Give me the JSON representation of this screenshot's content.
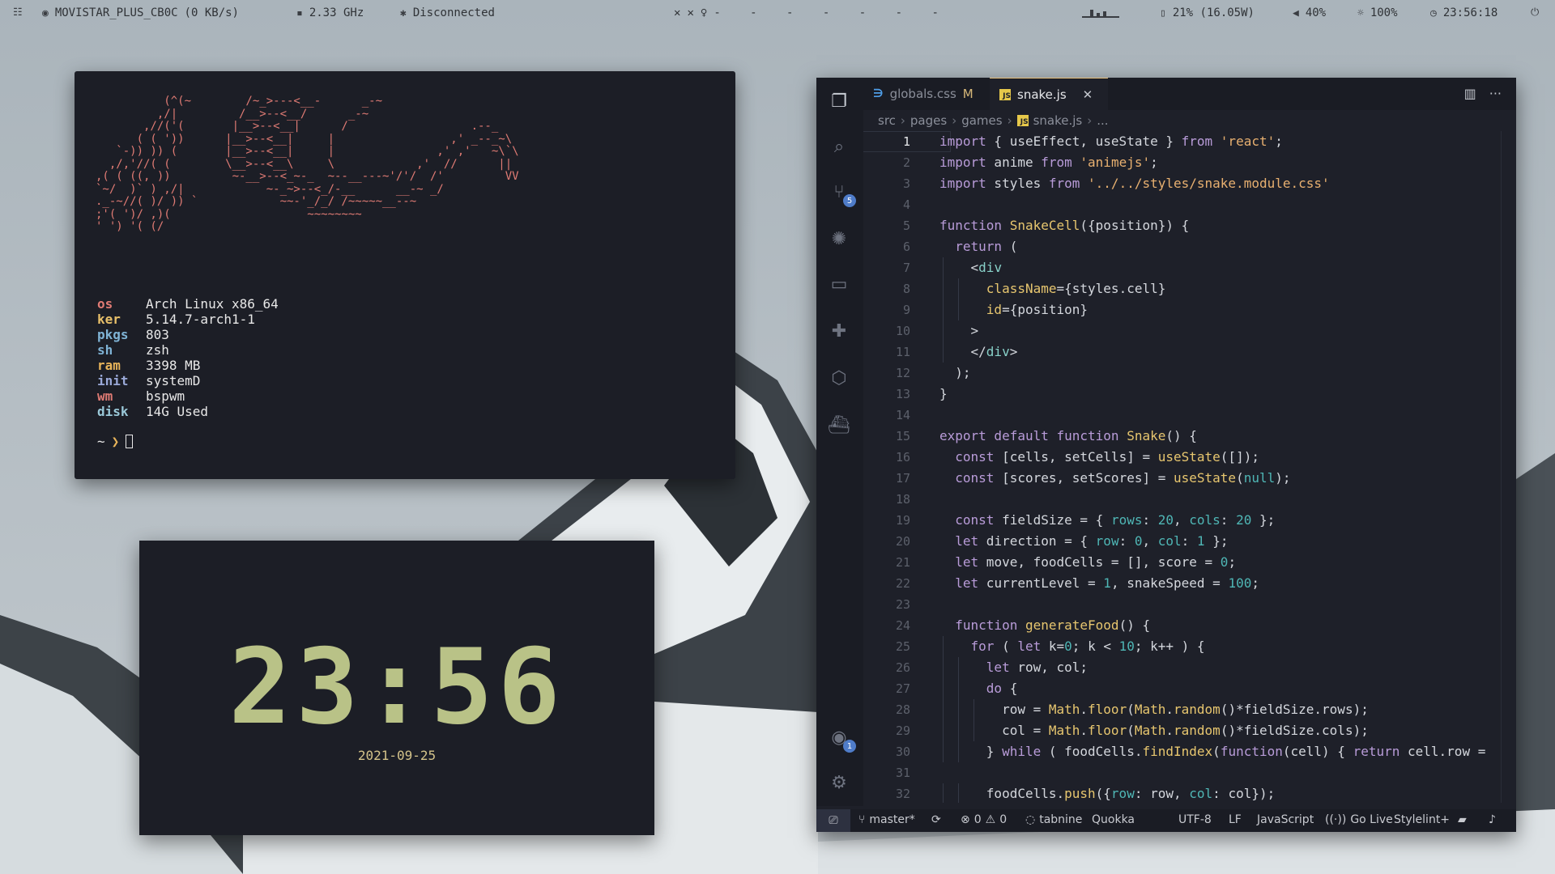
{
  "topbar": {
    "wifi_name": "MOVISTAR_PLUS_CB0C",
    "wifi_speed": "(0 KB/s)",
    "cpu_freq": "2.33 GHz",
    "bluetooth": "Disconnected",
    "workspace_dashes": "- - - - - - -",
    "battery": "21% (16.05W)",
    "volume": "40%",
    "brightness": "100%",
    "time": "23:56:18"
  },
  "terminal": {
    "ascii_art": "          (^(~        /~_>---<__-      _-~\n         ,/|         /__>--<__/      _-~\n       ,//('(       |__>--<__|      /                  .--_\n      ( ( '))      |__>--<__|     |                 ,' _--_~\\\n   `-)) )) (       |__>--<__|     |               ,' ,'   ~\\`\\\n  ,/,'//( (        \\__>--<__\\     \\            ,'  //      ||\n,( ( ((, ))         ~-__>--<_~-_  ~--__---~'/'/  /'         VV\n`~/  )` ) ,/|            ~-_~>--<_/-__      __-~ _/\n._-~//( )/ )) `            ~~-'_/_/ /~~~~~__--~\n;'( ')/ ,)(                    ~~~~~~~~\n' ') '( (/",
    "info": [
      {
        "key": "os",
        "value": "Arch Linux x86_64",
        "color": "#e07b74"
      },
      {
        "key": "ker",
        "value": "5.14.7-arch1-1",
        "color": "#e8c06a"
      },
      {
        "key": "pkgs",
        "value": "803",
        "color": "#7fb3d5"
      },
      {
        "key": "sh",
        "value": "zsh",
        "color": "#7fb3d5"
      },
      {
        "key": "ram",
        "value": "3398 MB",
        "color": "#e8b45a"
      },
      {
        "key": "init",
        "value": "systemD",
        "color": "#9aa9d8"
      },
      {
        "key": "wm",
        "value": "bspwm",
        "color": "#e07b74"
      },
      {
        "key": "disk",
        "value": "14G Used",
        "color": "#9ac8d8"
      }
    ],
    "prompt_path": "~",
    "prompt_arrow": "❯"
  },
  "clock": {
    "time": "23:56",
    "date": "2021-09-25"
  },
  "vscode": {
    "tabs": [
      {
        "label": "globals.css",
        "modified": "M",
        "type": "css",
        "active": false
      },
      {
        "label": "snake.js",
        "modified": "",
        "type": "js",
        "active": true
      }
    ],
    "breadcrumb": [
      "src",
      "pages",
      "games",
      "snake.js",
      "..."
    ],
    "scm_badge": "5",
    "account_badge": "1",
    "code_lines": [
      "<span class=\"k\">import</span> { useEffect, useState } <span class=\"k\">from</span> <span class=\"s\">'react'</span>;",
      "<span class=\"k\">import</span> anime <span class=\"k\">from</span> <span class=\"s\">'animejs'</span>;",
      "<span class=\"k\">import</span> styles <span class=\"k\">from</span> <span class=\"s\">'../../styles/snake.module.css'</span>",
      "",
      "<span class=\"k\">function</span> <span class=\"f\">SnakeCell</span>({position}) {",
      "  <span class=\"k\">return</span> (",
      "    &lt;<span class=\"b\">div</span>",
      "      <span class=\"f\">className</span>={styles.cell}",
      "      <span class=\"f\">id</span>={position}",
      "    &gt;",
      "    &lt;/<span class=\"b\">div</span>&gt;",
      "  );",
      "}",
      "",
      "<span class=\"k\">export default function</span> <span class=\"f\">Snake</span>() {",
      "  <span class=\"k\">const</span> [cells, setCells] = <span class=\"f\">useState</span>([]);",
      "  <span class=\"k\">const</span> [scores, setScores] = <span class=\"f\">useState</span>(<span class=\"c\">null</span>);",
      "",
      "  <span class=\"k\">const</span> fieldSize = { <span class=\"c\">rows</span>: <span class=\"c\">20</span>, <span class=\"c\">cols</span>: <span class=\"c\">20</span> };",
      "  <span class=\"k\">let</span> direction = { <span class=\"c\">row</span>: <span class=\"c\">0</span>, <span class=\"c\">col</span>: <span class=\"c\">1</span> };",
      "  <span class=\"k\">let</span> move, foodCells = [], score = <span class=\"c\">0</span>;",
      "  <span class=\"k\">let</span> currentLevel = <span class=\"c\">1</span>, snakeSpeed = <span class=\"c\">100</span>;",
      "",
      "  <span class=\"k\">function</span> <span class=\"f\">generateFood</span>() {",
      "    <span class=\"k\">for</span> ( <span class=\"k\">let</span> k=<span class=\"c\">0</span>; k &lt; <span class=\"c\">10</span>; k++ ) {",
      "      <span class=\"k\">let</span> row, col;",
      "      <span class=\"k\">do</span> {",
      "        row = <span class=\"f\">Math</span>.<span class=\"f\">floor</span>(<span class=\"f\">Math</span>.<span class=\"f\">random</span>()*fieldSize.rows);",
      "        col = <span class=\"f\">Math</span>.<span class=\"f\">floor</span>(<span class=\"f\">Math</span>.<span class=\"f\">random</span>()*fieldSize.cols);",
      "      } <span class=\"k\">while</span> ( foodCells.<span class=\"f\">findIndex</span>(<span class=\"k\">function</span>(cell) { <span class=\"k\">return</span> cell.row =",
      "",
      "      foodCells.<span class=\"f\">push</span>({<span class=\"c\">row</span>: row, <span class=\"c\">col</span>: col});"
    ],
    "status": {
      "branch": "master*",
      "errors": "0",
      "warnings": "0",
      "tabnine": "tabnine",
      "quokka": "Quokka",
      "encoding": "UTF-8",
      "eol": "LF",
      "language": "JavaScript",
      "golive": "Go Live",
      "stylelint": "Stylelint+"
    }
  }
}
